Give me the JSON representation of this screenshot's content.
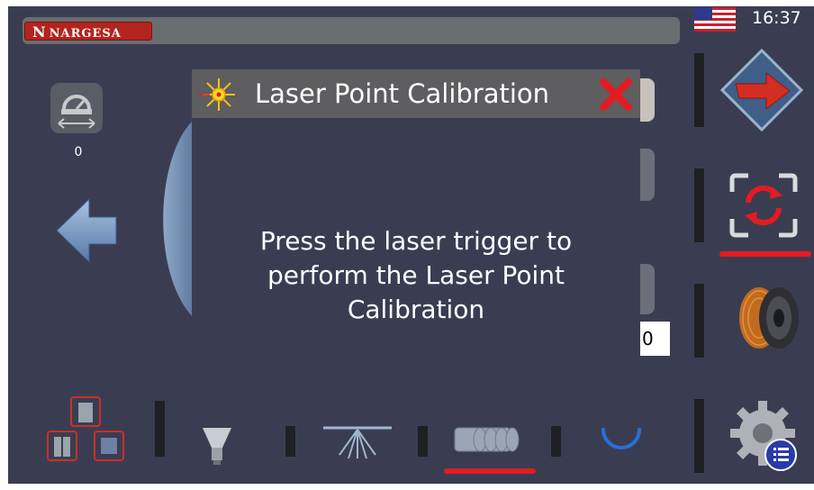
{
  "header": {
    "brand": "NARGESA",
    "brand_letter": "N",
    "clock": "16:37",
    "flag_icon": "us-flag-icon"
  },
  "left_panel": {
    "speed_value": "0"
  },
  "field": {
    "value": "0"
  },
  "dialog": {
    "title": "Laser Point Calibration",
    "message_line1": "Press the laser trigger to",
    "message_line2": "perform the Laser Point",
    "message_line3": "Calibration"
  },
  "colors": {
    "background": "#3a3d52",
    "accent_red": "#e41b23",
    "dialog_header": "#5e5d5f",
    "brand": "#b3241f"
  }
}
